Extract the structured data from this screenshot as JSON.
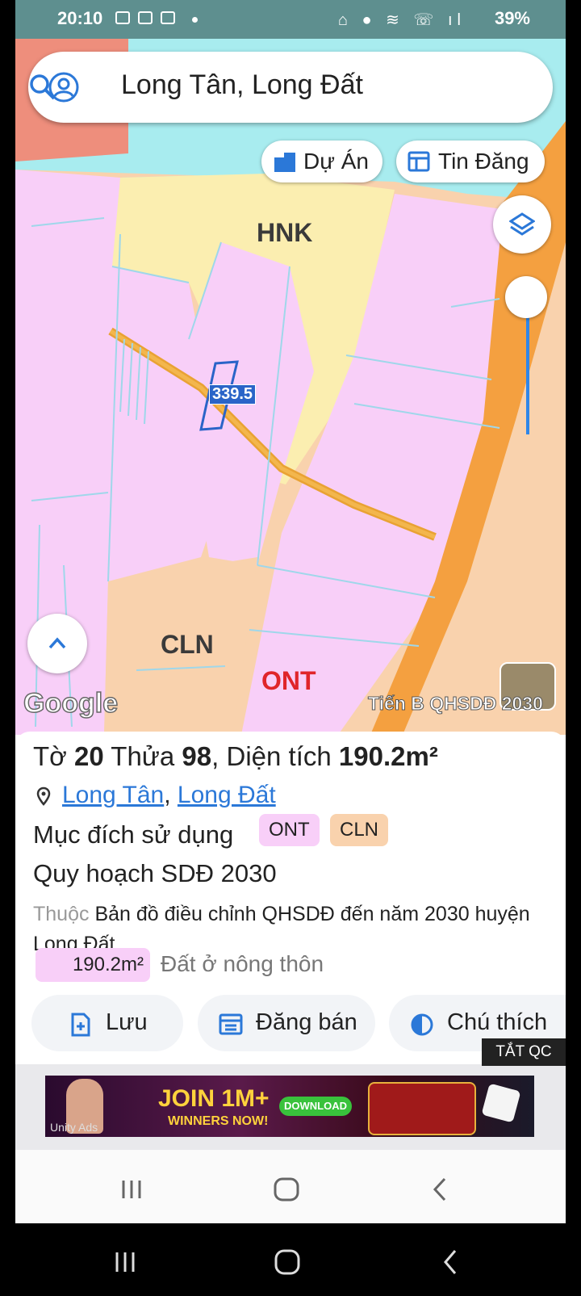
{
  "status_bar": {
    "time": "20:10",
    "battery": "39%"
  },
  "search": {
    "value": "Long Tân, Long Đất"
  },
  "chips": {
    "du_an": "Dự Án",
    "tin_dang": "Tin Đăng"
  },
  "map": {
    "labels": {
      "hnk": "HNK",
      "cln": "CLN",
      "ont": "ONT"
    },
    "parcel_label": "339.5",
    "google": "Google",
    "layer_tag": "Tiến B QHSDĐ 2030"
  },
  "info": {
    "line1": {
      "to_label": "Tờ",
      "to_value": "20",
      "thua_label": "Thửa",
      "thua_value": "98",
      "dt_label": "Diện tích",
      "dt_value": "190.2m²"
    },
    "location": {
      "ward": "Long Tân",
      "separator": ",",
      "district": "Long Đất"
    },
    "purpose_label": "Mục đích sử dụng",
    "purpose_badges": [
      {
        "text": "ONT",
        "color": "#f8cff8"
      },
      {
        "text": "CLN",
        "color": "#f9d2ad"
      }
    ],
    "plan_title": "Quy hoạch SDĐ 2030",
    "plan_desc_prefix": "Thuộc",
    "plan_desc": "Bản đồ điều chỉnh QHSDĐ đến năm 2030 huyện Long Đất",
    "area_value": "190.2m²",
    "area_desc": "Đất ở nông thôn"
  },
  "actions": {
    "save": "Lưu",
    "post": "Đăng bán",
    "legend": "Chú thích"
  },
  "ad": {
    "close": "TẮT QC",
    "headline": "JOIN 1M+",
    "sub": "WINNERS NOW!",
    "download": "DOWNLOAD",
    "brand": "Unity Ads"
  },
  "colors": {
    "ont_pink": "#f8cff8",
    "cln_orange": "#f9d2ad",
    "hnk_yellow": "#fbeeb0",
    "road_orange": "#f59f3a",
    "accent_blue": "#2b78d8"
  }
}
